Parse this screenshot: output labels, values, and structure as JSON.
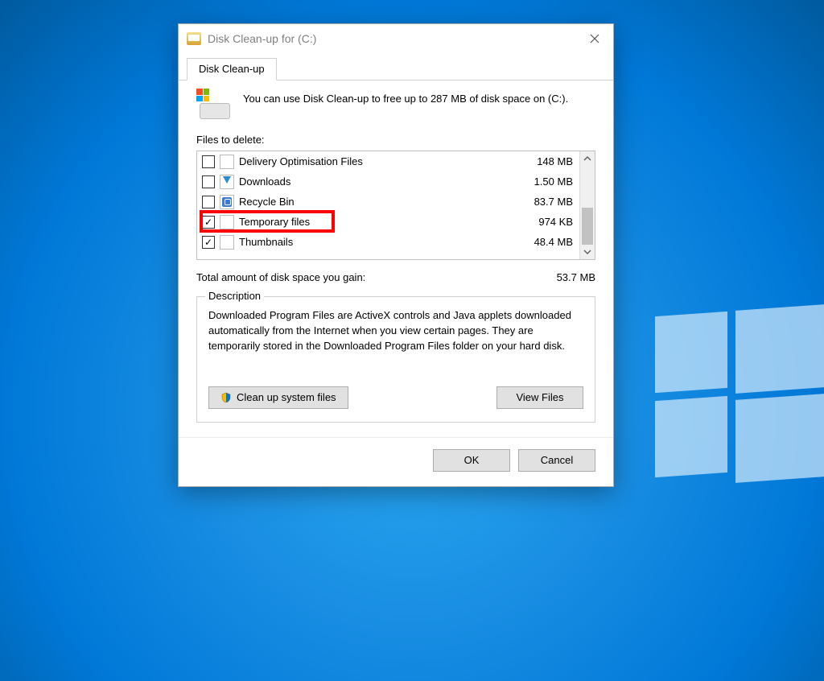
{
  "window": {
    "title": "Disk Clean-up for  (C:)"
  },
  "tab": {
    "label": "Disk Clean-up"
  },
  "intro": {
    "text": "You can use Disk Clean-up to free up to 287 MB of disk space on  (C:)."
  },
  "files_label": "Files to delete:",
  "files": [
    {
      "checked": false,
      "iconClass": "",
      "name": "Delivery Optimisation Files",
      "size": "148 MB",
      "highlight": false
    },
    {
      "checked": false,
      "iconClass": "dl",
      "name": "Downloads",
      "size": "1.50 MB",
      "highlight": false
    },
    {
      "checked": false,
      "iconClass": "bin",
      "name": "Recycle Bin",
      "size": "83.7 MB",
      "highlight": false
    },
    {
      "checked": true,
      "iconClass": "",
      "name": "Temporary files",
      "size": "974 KB",
      "highlight": true
    },
    {
      "checked": true,
      "iconClass": "",
      "name": "Thumbnails",
      "size": "48.4 MB",
      "highlight": false
    }
  ],
  "total": {
    "label": "Total amount of disk space you gain:",
    "value": "53.7 MB"
  },
  "description": {
    "legend": "Description",
    "text": "Downloaded Program Files are ActiveX controls and Java applets downloaded automatically from the Internet when you view certain pages. They are temporarily stored in the Downloaded Program Files folder on your hard disk."
  },
  "buttons": {
    "clean_system": "Clean up system files",
    "view_files": "View Files",
    "ok": "OK",
    "cancel": "Cancel"
  }
}
